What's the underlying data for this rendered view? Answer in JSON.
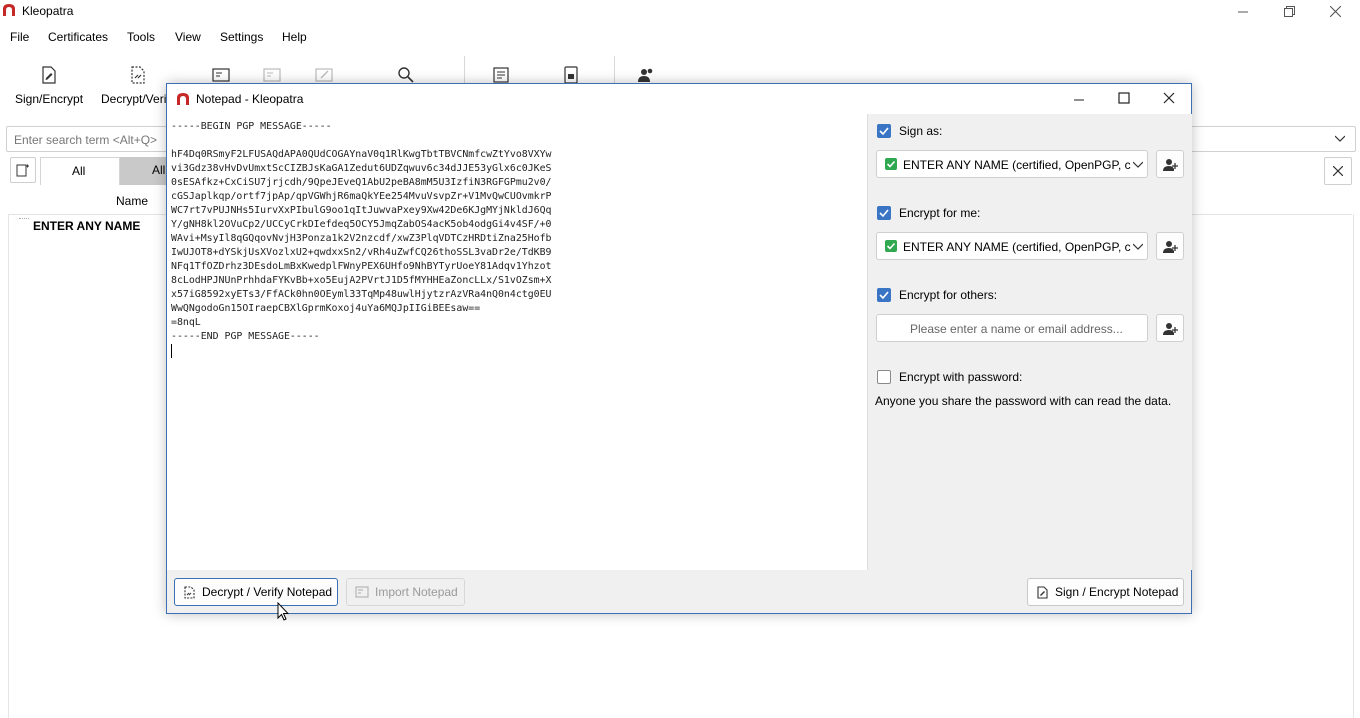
{
  "app": {
    "title": "Kleopatra"
  },
  "menu": [
    "File",
    "Certificates",
    "Tools",
    "View",
    "Settings",
    "Help"
  ],
  "toolbar": {
    "sign_encrypt": "Sign/Encrypt",
    "decrypt_verify": "Decrypt/Veri"
  },
  "search": {
    "placeholder": "Enter search term <Alt+Q>"
  },
  "tabs": {
    "all": "All",
    "all2": "All"
  },
  "table": {
    "column_name": "Name",
    "row1_name": "ENTER ANY NAME"
  },
  "notepad": {
    "title": "Notepad - Kleopatra",
    "content": "-----BEGIN PGP MESSAGE-----\n\nhF4Dq0RSmyF2LFUSAQdAPA0QUdCOGAYnaV0q1RlKwgTbtTBVCNmfcwZtYvo8VXYw\nvi3Gdz38vHvDvUmxtScCIZBJsKaGA1Zedut6UDZqwuv6c34dJJE53yGlx6c0JKeS\n0sESAfkz+CxCiSU7jrjcdh/9QpeJEveQ1AbU2peBA8mM5U3IzfiN3RGFGPmu2v0/\ncGSJaplkqp/ortf7jpAp/qpVGWhjR6maQkYEe254MvuVsvpZr+V1MvQwCUOvmkrP\nWC7rt7vPUJNHs5IurvXxPIbulG9oo1qItJuwvaPxey9Xw42De6KJgMYjNkldJ6Qq\nY/gNH8kl2OVuCp2/UCCyCrkDIefdeq5OCY5JmqZabOS4acK5ob4odgGi4v4SF/+0\nWAvi+MsyIl8qGQqovNvjH3Ponza1k2V2nzcdf/xwZ3PlqVDTCzHRDtiZna25Hofb\nIwUJOT8+dYSkjUsXVozlxU2+qwdxxSn2/vRh4uZwfCQ26thoSSL3vaDr2e/TdKB9\nNFq1TfOZDrhz3DEsdoLmBxKwedplFWnyPEX6UHfo9NhBYTyrUoeY81Adqv1Yhzot\n8cLodHPJNUnPrhhdaFYKvBb+xo5EujA2PVrtJ1D5fMYHHEaZoncLLx/S1vOZsm+X\nx57iG8592xyETs3/FfACk0hn0OEyml33TqMp48uwlHjytzrAzVRa4nQ0n4ctg0EU\nWwQNgodoGn15OIraepCBXlGprmKoxoj4uYa6MQJpIIGiBEEsaw==\n=8nqL\n-----END PGP MESSAGE-----",
    "sign_as_label": "Sign as:",
    "sign_as_value": "ENTER ANY NAME (certified, OpenPGP, cre",
    "encrypt_for_me_label": "Encrypt for me:",
    "encrypt_for_me_value": "ENTER ANY NAME (certified, OpenPGP, cre",
    "encrypt_for_others_label": "Encrypt for others:",
    "others_placeholder": "Please enter a name or email address...",
    "encrypt_password_label": "Encrypt with password:",
    "password_note": "Anyone you share the password with can read the data.",
    "decrypt_button": "Decrypt / Verify Notepad",
    "import_button": "Import Notepad",
    "sign_encrypt_button": "Sign / Encrypt Notepad",
    "sign_as_checked": true,
    "encrypt_for_me_checked": true,
    "encrypt_for_others_checked": true,
    "encrypt_password_checked": false
  },
  "colors": {
    "accent": "#3a74c4",
    "valid_green": "#2fa84f",
    "app_icon": "#c62828"
  }
}
